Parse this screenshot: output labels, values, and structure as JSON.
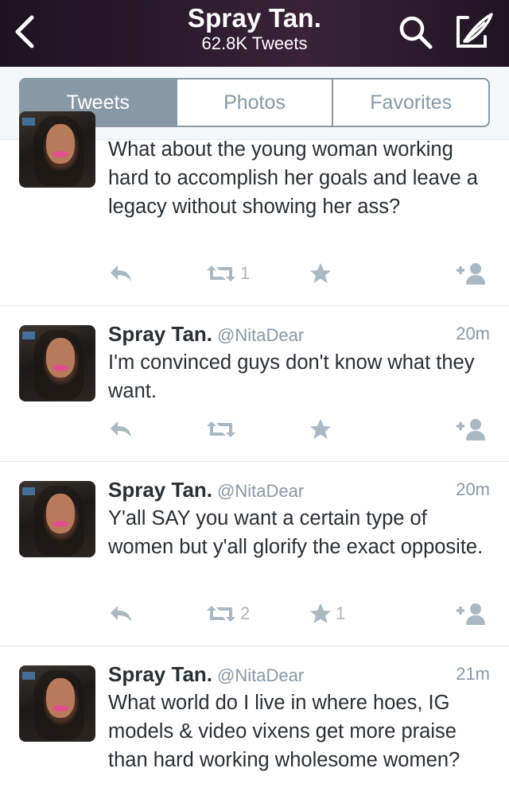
{
  "header": {
    "title": "Spray Tan.",
    "subtitle": "62.8K Tweets",
    "background": "#2a1a2c"
  },
  "tabs": [
    {
      "label": "Tweets",
      "active": true
    },
    {
      "label": "Photos",
      "active": false
    },
    {
      "label": "Favorites",
      "active": false
    }
  ],
  "tweets": [
    {
      "name": "",
      "handle": "",
      "time": "",
      "text": "What about the young woman working hard to accomplish her goals and leave a legacy without showing her ass?",
      "retweets": "1",
      "favorites": ""
    },
    {
      "name": "Spray Tan.",
      "handle": "@NitaDear",
      "time": "20m",
      "text": "I'm convinced guys don't know what they want.",
      "retweets": "",
      "favorites": ""
    },
    {
      "name": "Spray Tan.",
      "handle": "@NitaDear",
      "time": "20m",
      "text": "Y'all SAY you want a certain type of women but y'all glorify the exact opposite.",
      "retweets": "2",
      "favorites": "1"
    },
    {
      "name": "Spray Tan.",
      "handle": "@NitaDear",
      "time": "21m",
      "text": "What world do I live in where hoes, IG models & video vixens get more praise than hard working wholesome women?",
      "retweets": "",
      "favorites": ""
    }
  ],
  "icons": {
    "back": "chevron-left-icon",
    "search": "search-icon",
    "compose": "compose-icon",
    "reply": "reply-icon",
    "retweet": "retweet-icon",
    "favorite": "star-icon",
    "follow": "follow-icon"
  },
  "colors": {
    "accent_gray": "#8899a6",
    "action_gray": "#aab8c2",
    "text": "#292f33"
  }
}
